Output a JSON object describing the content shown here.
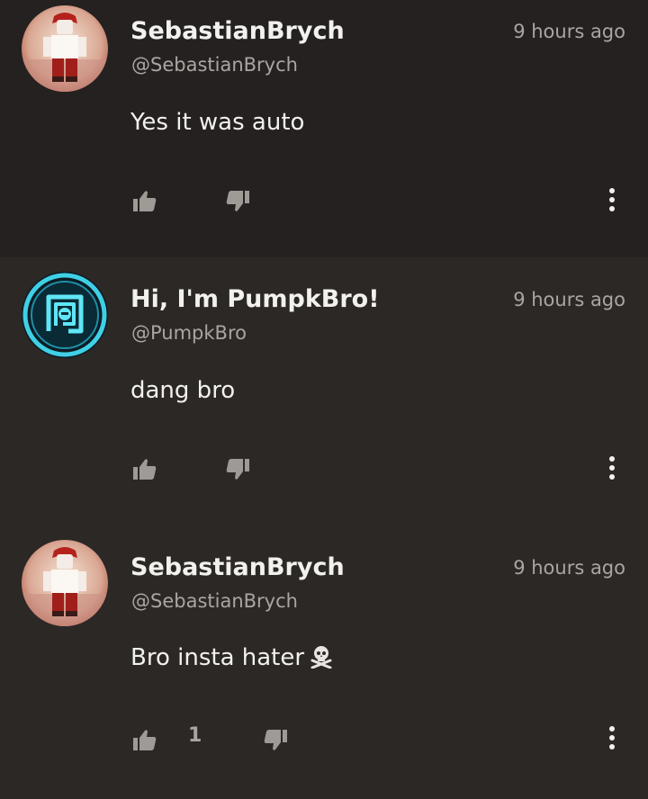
{
  "comments": [
    {
      "display_name": "SebastianBrych",
      "handle": "@SebastianBrych",
      "time": "9 hours ago",
      "text": "Yes it was auto",
      "likes": "",
      "avatar_icon": "roblox-avatar-red"
    },
    {
      "display_name": "Hi, I'm PumpkBro!",
      "handle": "@PumpkBro",
      "time": "9 hours ago",
      "text": "dang bro",
      "likes": "",
      "avatar_icon": "cyan-maze-logo"
    },
    {
      "display_name": "SebastianBrych",
      "handle": "@SebastianBrych",
      "time": "9 hours ago",
      "text": "Bro insta hater",
      "emoji": "☠️",
      "likes": "1",
      "avatar_icon": "roblox-avatar-red"
    }
  ],
  "icons": {
    "like": "thumbs-up-icon",
    "dislike": "thumbs-down-icon",
    "more": "vertical-dots-icon"
  },
  "colors": {
    "background": "#2b2826",
    "highlight_background": "#242120",
    "text_primary": "#f3f1ee",
    "text_secondary": "#a9a6a2",
    "icon": "#9e9b97",
    "avatar_ring_blue": "#3fd0e6"
  }
}
